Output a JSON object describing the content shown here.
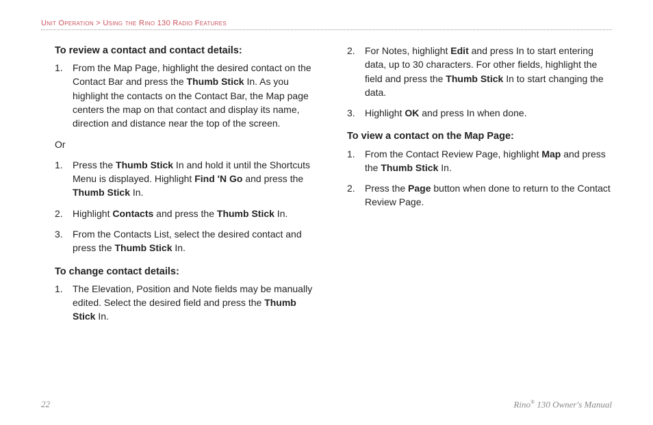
{
  "breadcrumb": {
    "section": "Unit Operation",
    "separator": " > ",
    "subsection": "Using the Rino 130 Radio Features"
  },
  "col1": {
    "heading1": "To review a contact and contact details:",
    "item1_num": "1.",
    "item1_a": "From the Map Page, highlight the desired contact on the Contact Bar and press the ",
    "item1_b": "Thumb Stick",
    "item1_c": " In. As you highlight the contacts on the Contact Bar, the Map page centers the map on that contact and display its name, direction and distance near the top of the screen.",
    "or": "Or",
    "item2_num": "1.",
    "item2_a": "Press the ",
    "item2_b": "Thumb Stick",
    "item2_c": " In and hold it until the Shortcuts Menu is displayed. Highlight ",
    "item2_d": "Find 'N Go",
    "item2_e": " and press the ",
    "item2_f": "Thumb Stick",
    "item2_g": " In.",
    "item3_num": "2.",
    "item3_a": "Highlight ",
    "item3_b": "Contacts",
    "item3_c": " and press the ",
    "item3_d": "Thumb Stick",
    "item3_e": " In.",
    "item4_num": "3.",
    "item4_a": "From the Contacts List, select the desired contact and press the ",
    "item4_b": "Thumb Stick",
    "item4_c": " In.",
    "heading2": "To change contact details:",
    "item5_num": "1.",
    "item5_a": "The Elevation, Position and Note fields may be manually edited. Select the desired field and press the ",
    "item5_b": "Thumb Stick",
    "item5_c": " In."
  },
  "col2": {
    "item1_num": "2.",
    "item1_a": "For Notes, highlight ",
    "item1_b": "Edit",
    "item1_c": " and press In to start entering data, up to 30 characters. For other fields, highlight the field and press the ",
    "item1_d": "Thumb Stick",
    "item1_e": " In to start changing the data.",
    "item2_num": "3.",
    "item2_a": "Highlight ",
    "item2_b": "OK",
    "item2_c": " and press In when done.",
    "heading1": "To view a contact on the Map Page:",
    "item3_num": "1.",
    "item3_a": "From the Contact Review Page, highlight ",
    "item3_b": "Map",
    "item3_c": " and press the ",
    "item3_d": "Thumb Stick",
    "item3_e": " In.",
    "item4_num": "2.",
    "item4_a": "Press the ",
    "item4_b": "Page",
    "item4_c": " button when done to return to the Contact Review Page."
  },
  "footer": {
    "page": "22",
    "product_a": "Rino",
    "product_b": "®",
    "product_c": " 130 Owner's Manual"
  }
}
